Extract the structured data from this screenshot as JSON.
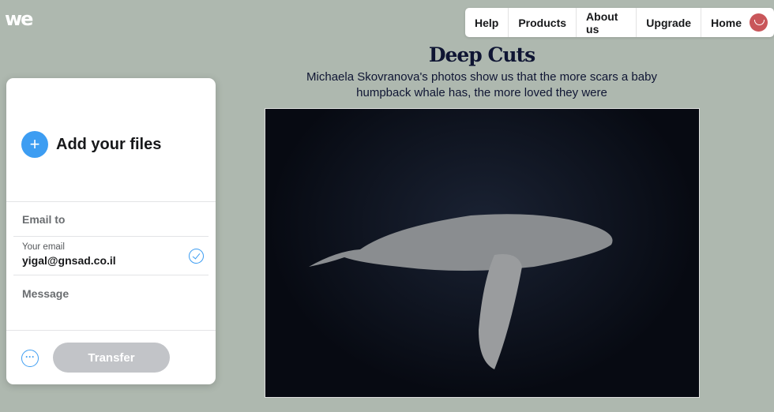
{
  "logo": "we",
  "nav": {
    "items": [
      "Help",
      "Products",
      "About us",
      "Upgrade",
      "Home"
    ]
  },
  "article": {
    "title": "Deep Cuts",
    "subtitle": "Michaela Skovranova's photos show us that the more scars a baby humpback whale has, the more loved they were"
  },
  "upload": {
    "add_label": "Add your files",
    "email_to": "Email to",
    "your_email_label": "Your email",
    "your_email_value": "yigal@gnsad.co.il",
    "message": "Message",
    "transfer": "Transfer",
    "more": "···"
  },
  "colors": {
    "accent": "#3d9df2",
    "background": "#aeb8af",
    "avatar": "#c9565a"
  }
}
